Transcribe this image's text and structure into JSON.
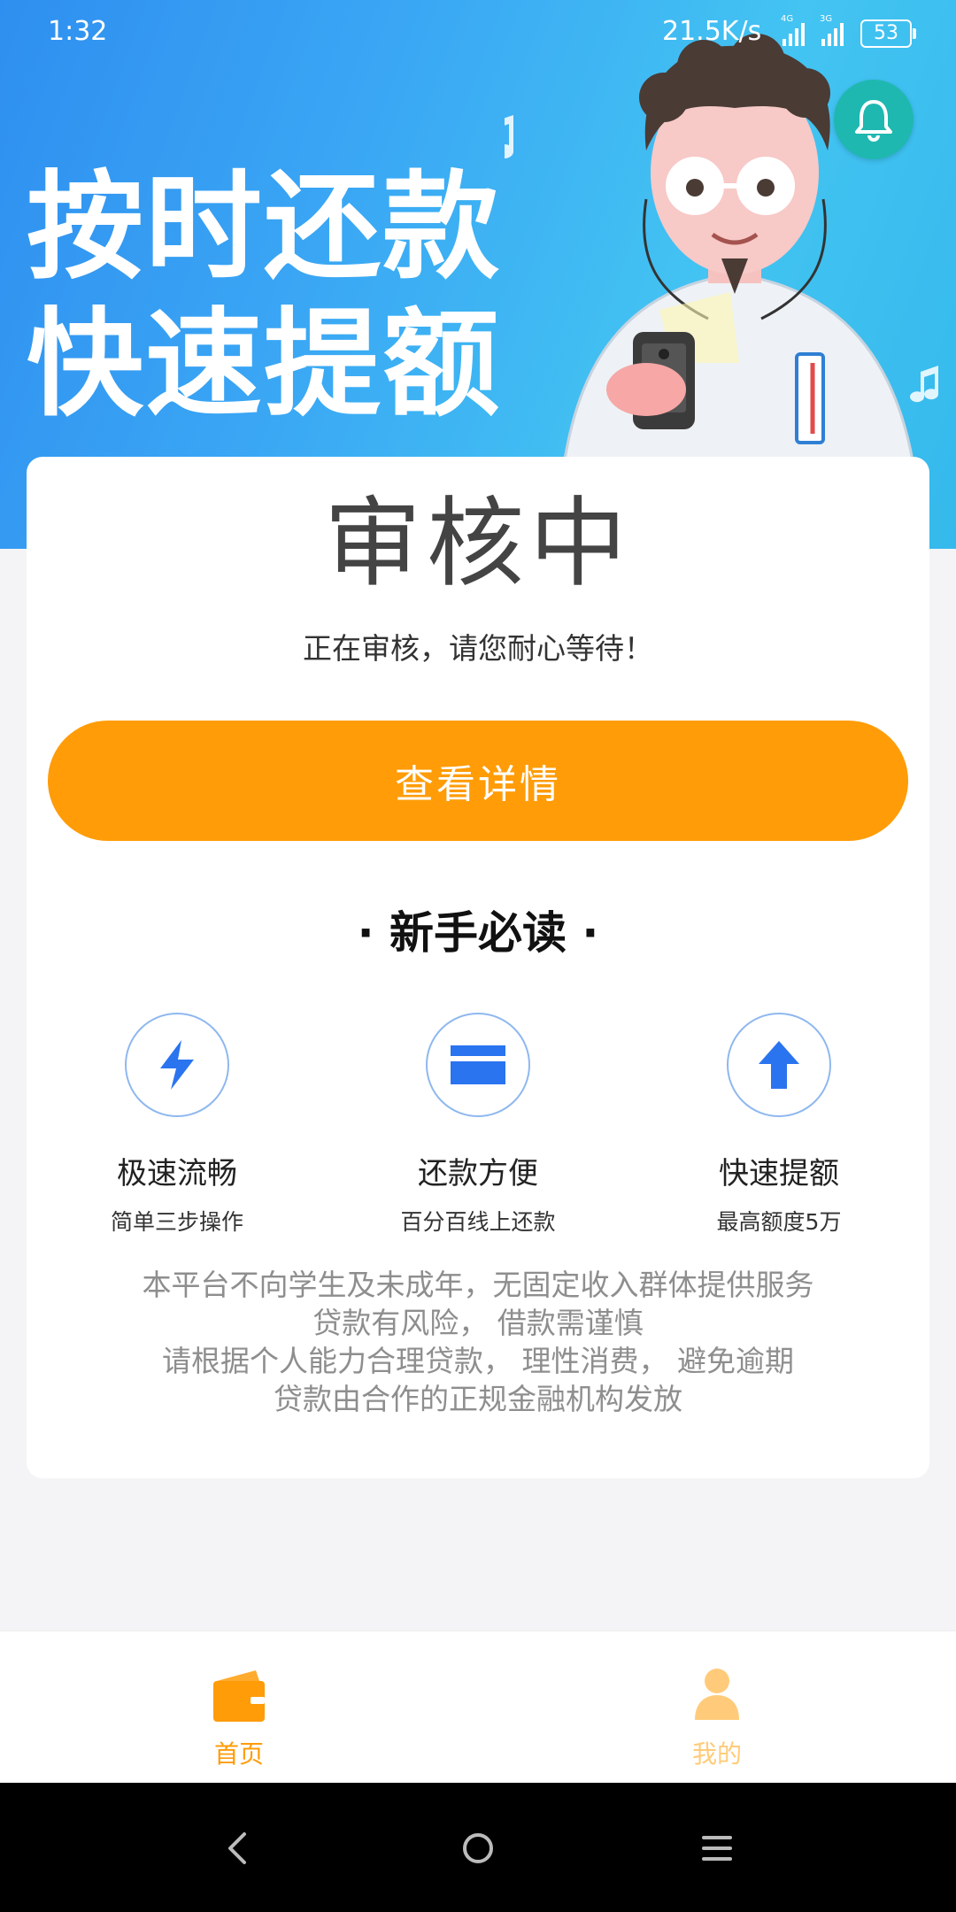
{
  "status_bar": {
    "time": "1:32",
    "speed": "21.5K/s",
    "signal1": "4G",
    "signal2": "3G",
    "battery": "53"
  },
  "banner": {
    "line1": "按时还款",
    "line2": "快速提额"
  },
  "review": {
    "status": "审核中",
    "message": "正在审核，请您耐心等待！",
    "detail_button": "查看详情"
  },
  "guide": {
    "title": "· 新手必读 ·",
    "features": [
      {
        "title": "极速流畅",
        "desc": "简单三步操作",
        "icon": "lightning-icon"
      },
      {
        "title": "还款方便",
        "desc": "百分百线上还款",
        "icon": "card-icon"
      },
      {
        "title": "快速提额",
        "desc": "最高额度5万",
        "icon": "arrow-up-icon"
      }
    ]
  },
  "notice": [
    "本平台不向学生及未成年，无固定收入群体提供服务",
    "贷款有风险， 借款需谨慎",
    "请根据个人能力合理贷款， 理性消费， 避免逾期",
    "贷款由合作的正规金融机构发放"
  ],
  "tabs": [
    {
      "label": "首页",
      "icon": "wallet-icon",
      "active": true
    },
    {
      "label": "我的",
      "icon": "person-icon",
      "active": false
    }
  ],
  "colors": {
    "accent": "#ff9c08",
    "icon_blue": "#2a74f0",
    "tab_inactive": "#ffcb7a"
  }
}
